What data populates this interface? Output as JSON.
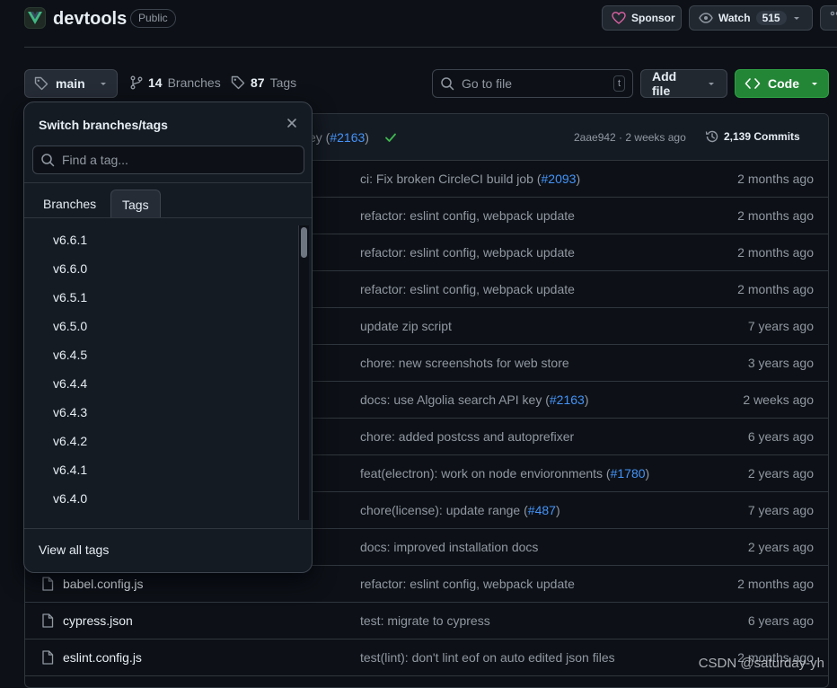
{
  "repo": {
    "name": "devtools",
    "visibility": "Public"
  },
  "header": {
    "sponsor_label": "Sponsor",
    "watch_label": "Watch",
    "watch_count": "515"
  },
  "toolbar": {
    "branch": "main",
    "branches_count": "14",
    "branches_label": "Branches",
    "tags_count": "87",
    "tags_label": "Tags",
    "goto_placeholder": "Go to file",
    "goto_shortcut": "t",
    "add_file_label": "Add file",
    "code_label": "Code"
  },
  "latest_commit": {
    "msg_tail": "ey (",
    "pr": "#2163",
    "msg_close": ")",
    "sha": "2aae942",
    "sep": " · ",
    "age": "2 weeks ago",
    "commits_count": "2,139 Commits"
  },
  "files": [
    {
      "name": "",
      "msg": "ci: Fix broken CircleCI build job (",
      "pr": "#2093",
      "tail": ")",
      "age": "2 months ago"
    },
    {
      "name": "",
      "msg": "refactor: eslint config, webpack update",
      "pr": "",
      "tail": "",
      "age": "2 months ago"
    },
    {
      "name": "",
      "msg": "refactor: eslint config, webpack update",
      "pr": "",
      "tail": "",
      "age": "2 months ago"
    },
    {
      "name": "",
      "msg": "refactor: eslint config, webpack update",
      "pr": "",
      "tail": "",
      "age": "2 months ago"
    },
    {
      "name": "",
      "msg": "update zip script",
      "pr": "",
      "tail": "",
      "age": "7 years ago"
    },
    {
      "name": "",
      "msg": "chore: new screenshots for web store",
      "pr": "",
      "tail": "",
      "age": "3 years ago"
    },
    {
      "name": "",
      "msg": "docs: use Algolia search API key (",
      "pr": "#2163",
      "tail": ")",
      "age": "2 weeks ago"
    },
    {
      "name": "",
      "msg": "chore: added postcss and autoprefixer",
      "pr": "",
      "tail": "",
      "age": "6 years ago"
    },
    {
      "name": "",
      "msg": "feat(electron): work on node envioronments (",
      "pr": "#1780",
      "tail": ")",
      "age": "2 years ago"
    },
    {
      "name": "",
      "msg": "chore(license): update range (",
      "pr": "#487",
      "tail": ")",
      "age": "7 years ago"
    },
    {
      "name": "",
      "msg": "docs: improved installation docs",
      "pr": "",
      "tail": "",
      "age": "2 years ago"
    },
    {
      "name": "babel.config.js",
      "msg": "refactor: eslint config, webpack update",
      "pr": "",
      "tail": "",
      "age": "2 months ago"
    },
    {
      "name": "cypress.json",
      "msg": "test: migrate to cypress",
      "pr": "",
      "tail": "",
      "age": "6 years ago"
    },
    {
      "name": "eslint.config.js",
      "msg": "test(lint): don't lint eof on auto edited json files",
      "pr": "",
      "tail": "",
      "age": "2 months ago"
    }
  ],
  "dropdown": {
    "title": "Switch branches/tags",
    "search_placeholder": "Find a tag...",
    "tabs": [
      "Branches",
      "Tags"
    ],
    "active_tab": "Tags",
    "tags": [
      "v6.6.1",
      "v6.6.0",
      "v6.5.1",
      "v6.5.0",
      "v6.4.5",
      "v6.4.4",
      "v6.4.3",
      "v6.4.2",
      "v6.4.1",
      "v6.4.0"
    ],
    "footer": "View all tags"
  },
  "watermark": "CSDN @saturday-yh",
  "colors": {
    "accent_green": "#238636",
    "link": "#4493f8",
    "vue_green": "#41b883"
  }
}
